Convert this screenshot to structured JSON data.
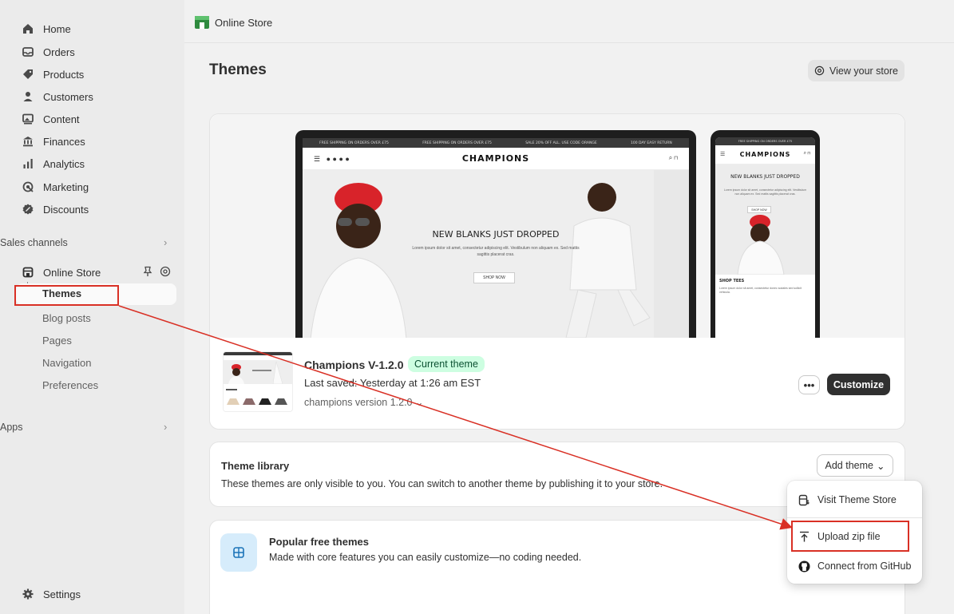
{
  "topbar": {
    "title": "Online Store"
  },
  "sidebar": {
    "items": [
      {
        "label": "Home",
        "icon": "home-icon"
      },
      {
        "label": "Orders",
        "icon": "inbox-icon"
      },
      {
        "label": "Products",
        "icon": "tag-icon"
      },
      {
        "label": "Customers",
        "icon": "person-icon"
      },
      {
        "label": "Content",
        "icon": "image-icon"
      },
      {
        "label": "Finances",
        "icon": "bank-icon"
      },
      {
        "label": "Analytics",
        "icon": "bar-chart-icon"
      },
      {
        "label": "Marketing",
        "icon": "target-icon"
      },
      {
        "label": "Discounts",
        "icon": "discount-icon"
      }
    ],
    "sales_channels_label": "Sales channels",
    "online_store": "Online Store",
    "sub_items": [
      "Themes",
      "Blog posts",
      "Pages",
      "Navigation",
      "Preferences"
    ],
    "apps_label": "Apps",
    "settings": "Settings"
  },
  "page": {
    "title": "Themes",
    "view_store": "View your store"
  },
  "preview": {
    "announcement": [
      "FREE SHIPPING ON ORDERS OVER £75",
      "FREE SHIPPING ON ORDERS OVER £75",
      "SALE 20% OFF ALL. USE CODE ORANGE",
      "100 DAY EASY RETURN"
    ],
    "brand": "CHAMPIONS",
    "headline": "NEW BLANKS JUST DROPPED",
    "subtext": "Lorem ipsum dolor sit amet, consectetur adipiscing elit. Vestibulum non aliquam ex. Sed mattis sagittis placerat cras.",
    "shop_now": "SHOP NOW",
    "mobile_headline": "NEW BLANKS JUST DROPPED",
    "mobile_section": "SHOP TEES",
    "mobile_section_sub": "Lorem ipsum dolor sit amet, consectetur donec sodales sed sollicit vehicula."
  },
  "current_theme": {
    "name": "Champions V-1.2.0",
    "badge": "Current theme",
    "last_saved": "Last saved: Yesterday at 1:26 am EST",
    "version": "champions version 1.2.0",
    "more": "•••",
    "customize": "Customize"
  },
  "library": {
    "title": "Theme library",
    "description": "These themes are only visible to you. You can switch to another theme by publishing it to your store.",
    "add_theme": "Add theme"
  },
  "popular": {
    "title": "Popular free themes",
    "description": "Made with core features you can easily customize—no coding needed."
  },
  "dropdown": {
    "items": [
      {
        "label": "Visit Theme Store",
        "icon": "theme-store-icon"
      },
      {
        "label": "Upload zip file",
        "icon": "upload-icon"
      },
      {
        "label": "Connect from GitHub",
        "icon": "github-icon"
      }
    ]
  },
  "colors": {
    "annotation": "#d93025",
    "primary_button": "#303030",
    "badge_bg": "#cdfee1"
  }
}
